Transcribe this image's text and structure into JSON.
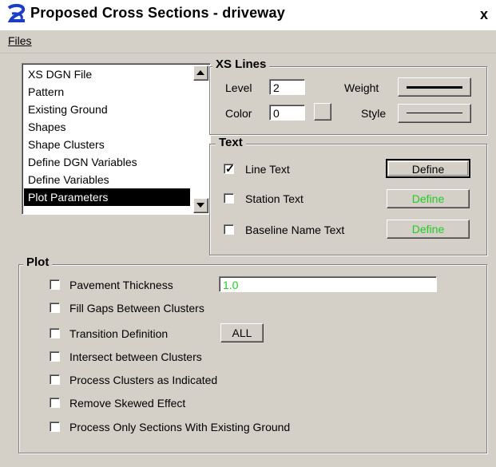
{
  "window": {
    "title": "Proposed Cross Sections - driveway",
    "close_label": "x",
    "menu": {
      "files": "Files"
    }
  },
  "list": {
    "items": [
      "XS DGN File",
      "Pattern",
      "Existing Ground",
      "Shapes",
      "Shape Clusters",
      "Define DGN Variables",
      "Define Variables",
      "Plot Parameters"
    ],
    "selected": "Plot Parameters"
  },
  "xs_lines": {
    "title": "XS Lines",
    "level_label": "Level",
    "level_value": "2",
    "color_label": "Color",
    "color_value": "0",
    "weight_label": "Weight",
    "style_label": "Style"
  },
  "text": {
    "title": "Text",
    "line_text": {
      "label": "Line Text",
      "checked": true,
      "button": "Define"
    },
    "station_text": {
      "label": "Station Text",
      "checked": false,
      "button": "Define"
    },
    "baseline_text": {
      "label": "Baseline Name Text",
      "checked": false,
      "button": "Define"
    }
  },
  "plot": {
    "title": "Plot",
    "pavement_thickness": {
      "label": "Pavement Thickness",
      "value": "1.0",
      "checked": false
    },
    "fill_gaps": {
      "label": "Fill Gaps Between Clusters",
      "checked": false
    },
    "transition": {
      "label": "Transition Definition",
      "button": "ALL",
      "checked": false
    },
    "intersect": {
      "label": "Intersect between Clusters",
      "checked": false
    },
    "process_clusters": {
      "label": "Process Clusters as Indicated",
      "checked": false
    },
    "remove_skewed": {
      "label": "Remove Skewed Effect",
      "checked": false
    },
    "process_only": {
      "label": "Process Only Sections With Existing Ground",
      "checked": false
    }
  },
  "colors": {
    "dialog_bg": "#d4d0c8",
    "disabled_text": "#22cc22",
    "selection": "#000000",
    "field_disabled_text": "#22cc22"
  }
}
